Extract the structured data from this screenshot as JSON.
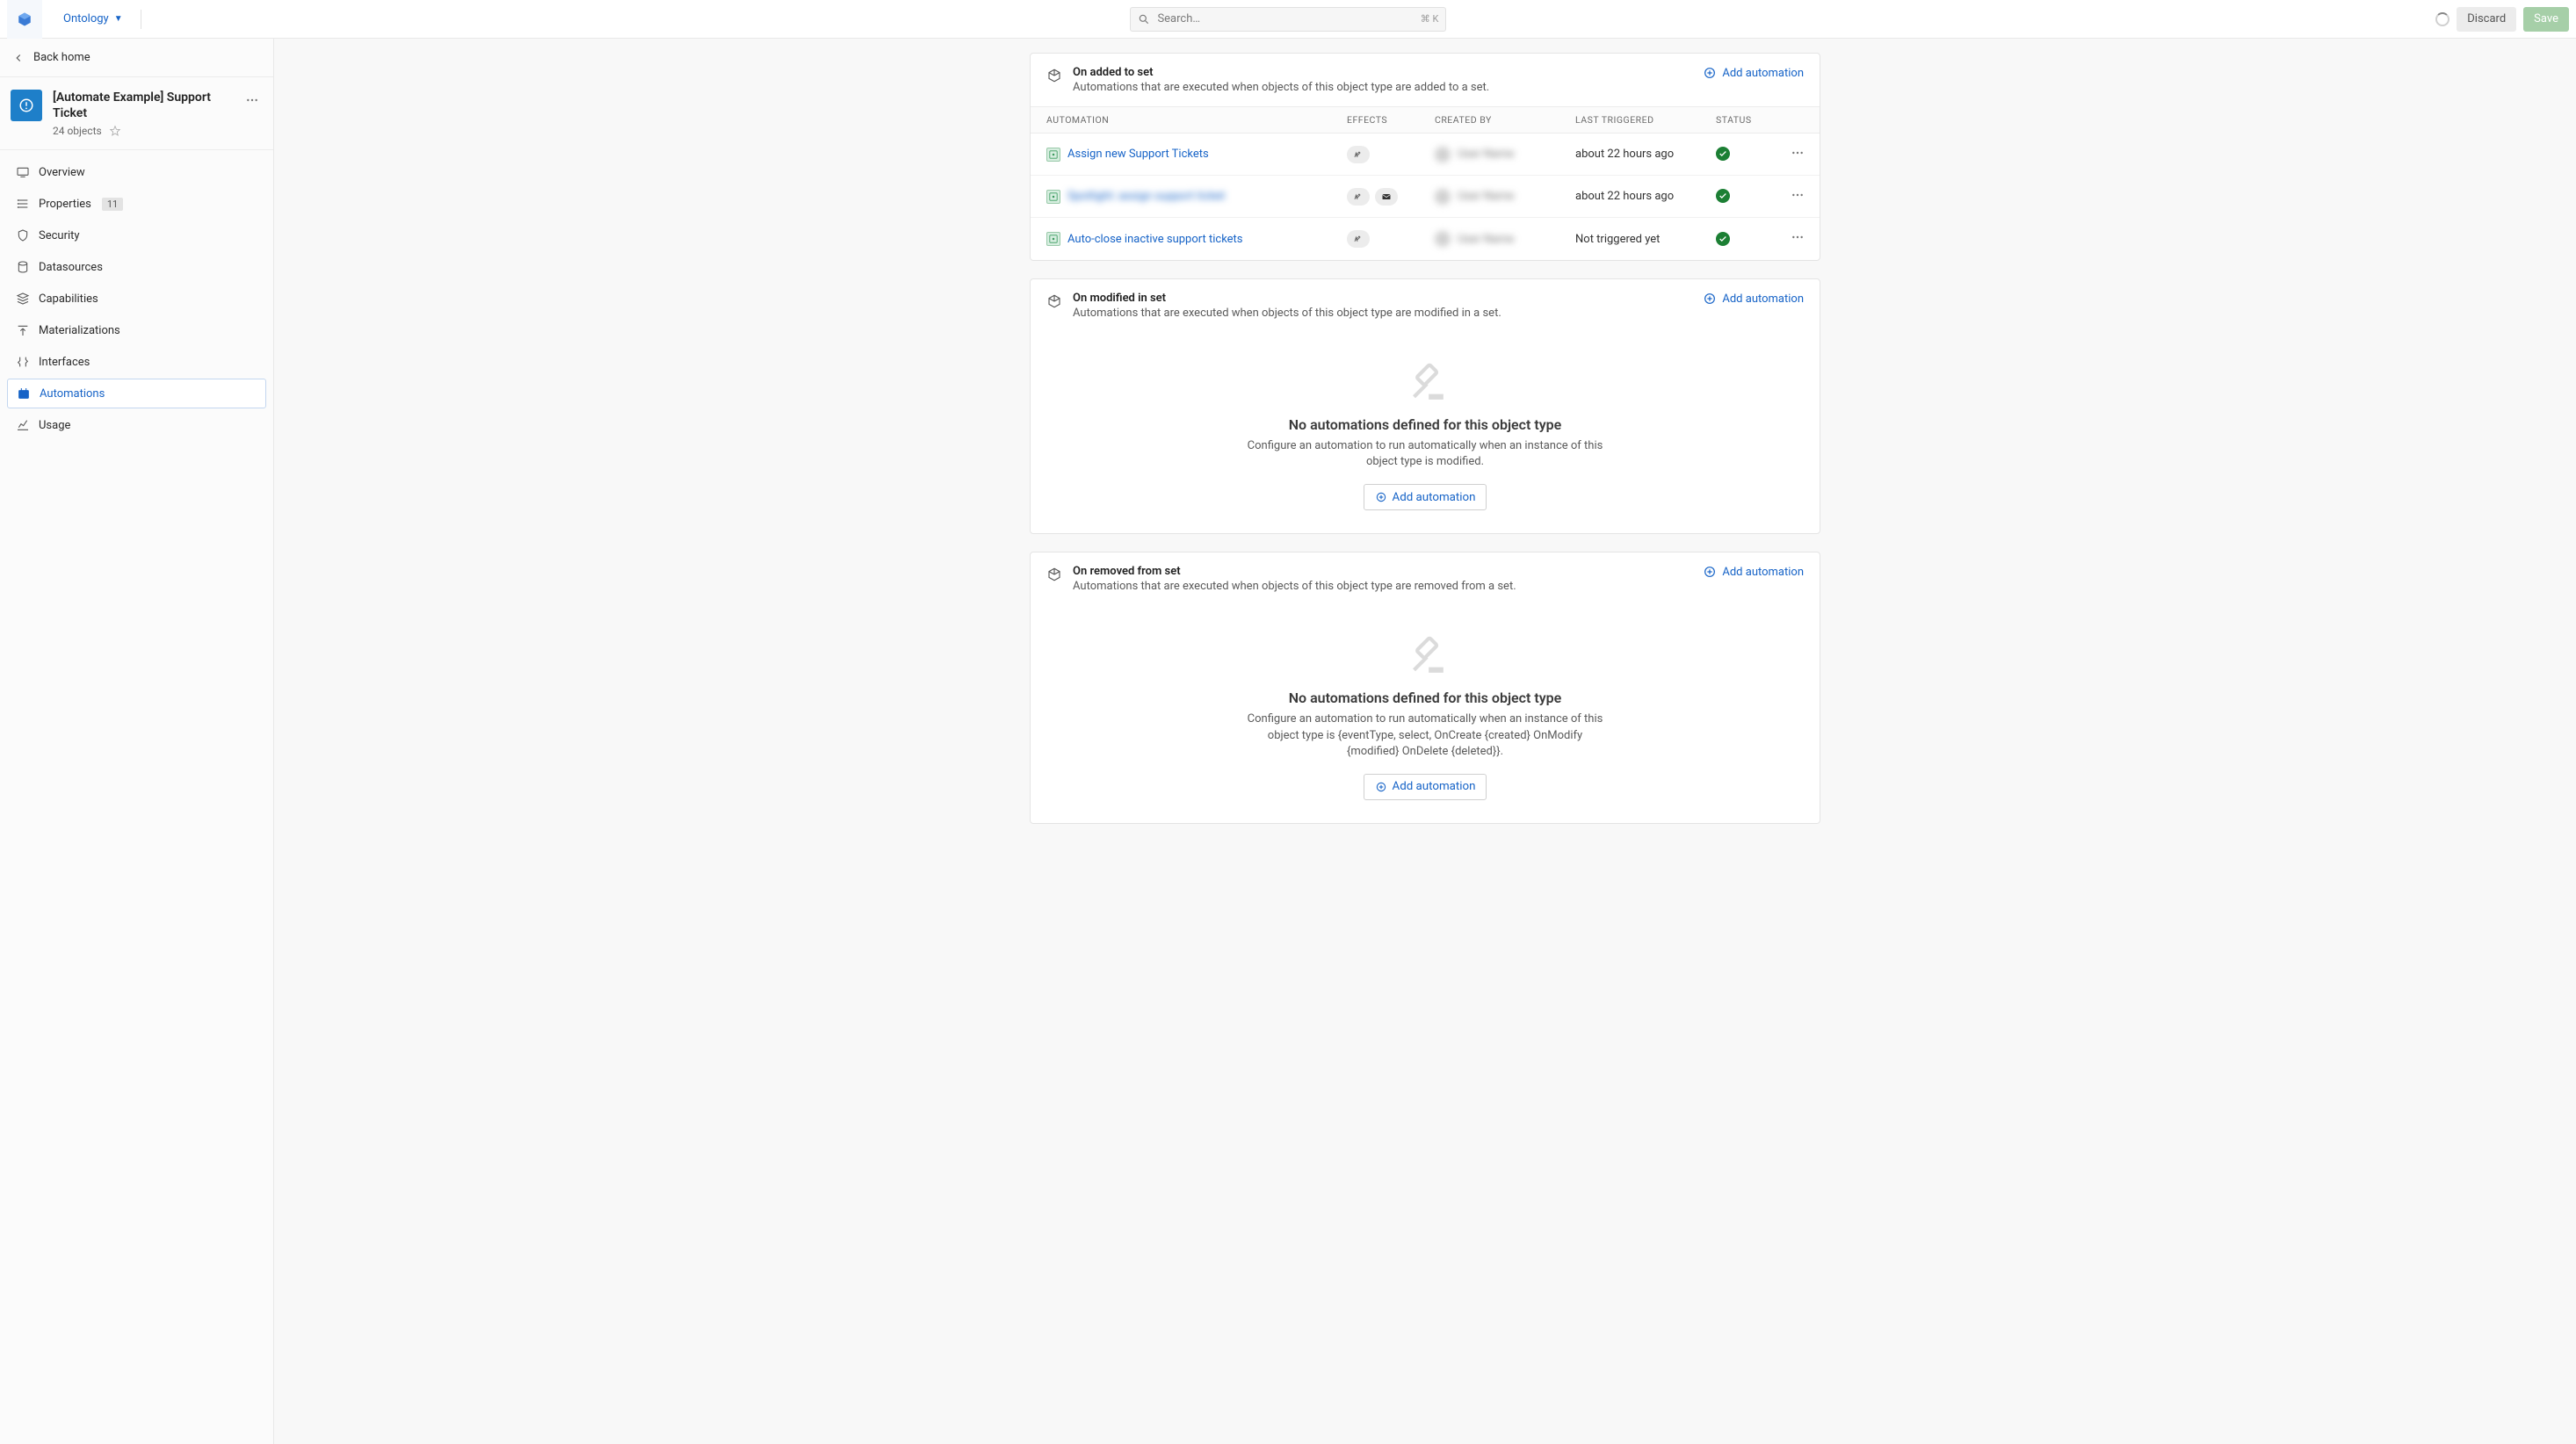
{
  "topbar": {
    "app_name": "Ontology",
    "search_placeholder": "Search…",
    "search_shortcut": "⌘ K",
    "discard": "Discard",
    "save": "Save"
  },
  "sidebar": {
    "back": "Back home",
    "entity_title": "[Automate Example] Support Ticket",
    "entity_sub": "24 objects",
    "nav": [
      {
        "key": "overview",
        "label": "Overview"
      },
      {
        "key": "properties",
        "label": "Properties",
        "badge": "11"
      },
      {
        "key": "security",
        "label": "Security"
      },
      {
        "key": "datasources",
        "label": "Datasources"
      },
      {
        "key": "capabilities",
        "label": "Capabilities"
      },
      {
        "key": "materializations",
        "label": "Materializations"
      },
      {
        "key": "interfaces",
        "label": "Interfaces"
      },
      {
        "key": "automations",
        "label": "Automations",
        "active": true
      },
      {
        "key": "usage",
        "label": "Usage"
      }
    ]
  },
  "common": {
    "add_automation": "Add automation",
    "headers": {
      "automation": "Automation",
      "effects": "Effects",
      "created_by": "Created by",
      "last_triggered": "Last triggered",
      "status": "Status"
    },
    "empty_title": "No automations defined for this object type"
  },
  "sections": [
    {
      "key": "on_added",
      "icon": "cube-plus",
      "title": "On added to set",
      "desc": "Automations that are executed when objects of this object type are added to a set.",
      "rows": [
        {
          "name": "Assign new Support Tickets",
          "effects": [
            "action"
          ],
          "last_triggered": "about 22 hours ago",
          "created_by": "User Name"
        },
        {
          "name": "Spotlight: assign support ticket",
          "blurred": true,
          "effects": [
            "action",
            "mail"
          ],
          "last_triggered": "about 22 hours ago",
          "created_by": "User Name"
        },
        {
          "name": "Auto-close inactive support tickets",
          "effects": [
            "action"
          ],
          "last_triggered": "Not triggered yet",
          "created_by": "User Name"
        }
      ]
    },
    {
      "key": "on_modified",
      "icon": "cube-edit",
      "title": "On modified in set",
      "desc": "Automations that are executed when objects of this object type are modified in a set.",
      "empty_desc": "Configure an automation to run automatically when an instance of this object type is modified."
    },
    {
      "key": "on_removed",
      "icon": "cube-minus",
      "title": "On removed from set",
      "desc": "Automations that are executed when objects of this object type are removed from a set.",
      "empty_desc": "Configure an automation to run automatically when an instance of this object type is {eventType, select, OnCreate {created} OnModify {modified} OnDelete {deleted}}."
    }
  ]
}
